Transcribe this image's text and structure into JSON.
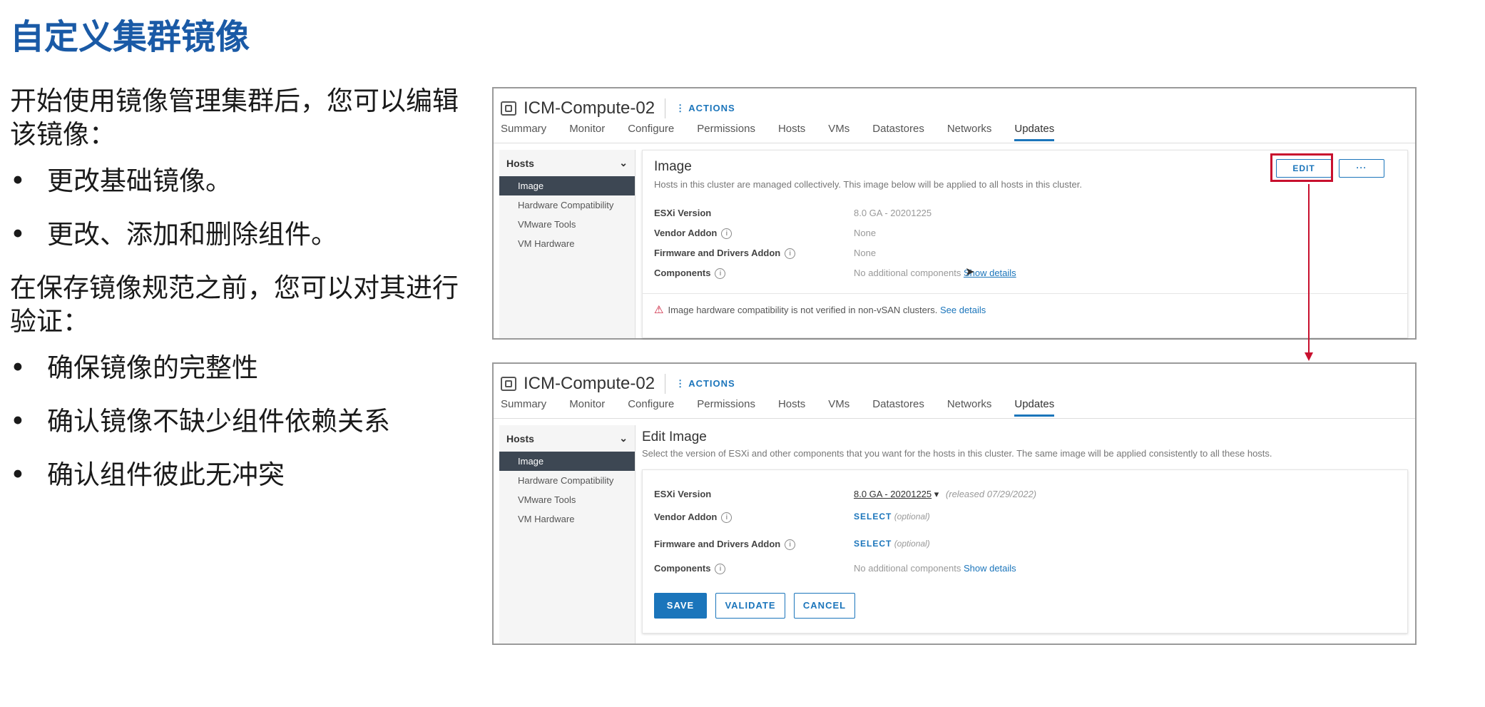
{
  "slide": {
    "title": "自定义集群镜像",
    "intro": "开始使用镜像管理集群后，您可以编辑该镜像：",
    "edit_bullets": [
      "更改基础镜像。",
      "更改、添加和删除组件。"
    ],
    "validate_intro": "在保存镜像规范之前，您可以对其进行验证：",
    "validate_bullets": [
      "确保镜像的完整性",
      "确认镜像不缺少组件依赖关系",
      "确认组件彼此无冲突"
    ],
    "bullet_char": "•"
  },
  "panel1": {
    "object_name": "ICM-Compute-02",
    "actions_label": "ACTIONS",
    "tabs": [
      "Summary",
      "Monitor",
      "Configure",
      "Permissions",
      "Hosts",
      "VMs",
      "Datastores",
      "Networks",
      "Updates"
    ],
    "active_tab": "Updates",
    "nav": {
      "head": "Hosts",
      "items": [
        "Image",
        "Hardware Compatibility",
        "VMware Tools",
        "VM Hardware"
      ]
    },
    "image": {
      "heading": "Image",
      "description": "Hosts in this cluster are managed collectively. This image below will be applied to all hosts in this cluster.",
      "edit_label": "EDIT",
      "more_label": "···",
      "rows": [
        {
          "key": "ESXi Version",
          "value": "8.0 GA - 20201225"
        },
        {
          "key": "Vendor Addon",
          "value": "None"
        },
        {
          "key": "Firmware and Drivers Addon",
          "value": "None"
        },
        {
          "key": "Components",
          "value": "No additional components",
          "link": "Show details"
        }
      ],
      "warning": "Image hardware compatibility is not verified in non-vSAN clusters.",
      "warning_link": "See details"
    }
  },
  "panel2": {
    "object_name": "ICM-Compute-02",
    "actions_label": "ACTIONS",
    "tabs": [
      "Summary",
      "Monitor",
      "Configure",
      "Permissions",
      "Hosts",
      "VMs",
      "Datastores",
      "Networks",
      "Updates"
    ],
    "active_tab": "Updates",
    "nav": {
      "head": "Hosts",
      "items": [
        "Image",
        "Hardware Compatibility",
        "VMware Tools",
        "VM Hardware"
      ]
    },
    "edit_image": {
      "heading": "Edit Image",
      "description": "Select the version of ESXi and other components that you want for the hosts in this cluster. The same image will be applied consistently to all these hosts.",
      "esxi_key": "ESXi Version",
      "esxi_value": "8.0 GA - 20201225",
      "esxi_released": "(released 07/29/2022)",
      "vendor_key": "Vendor Addon",
      "vendor_select": "SELECT",
      "vendor_optional": "(optional)",
      "firmware_key": "Firmware and Drivers Addon",
      "firmware_select": "SELECT",
      "firmware_optional": "(optional)",
      "components_key": "Components",
      "components_value": "No additional components",
      "components_link": "Show details",
      "save_label": "SAVE",
      "validate_label": "VALIDATE",
      "cancel_label": "CANCEL"
    }
  },
  "colors": {
    "title_blue": "#1a5aa6",
    "accent_blue": "#1b75bb",
    "highlight_red": "#c8102e",
    "nav_selected": "#3d4753"
  }
}
